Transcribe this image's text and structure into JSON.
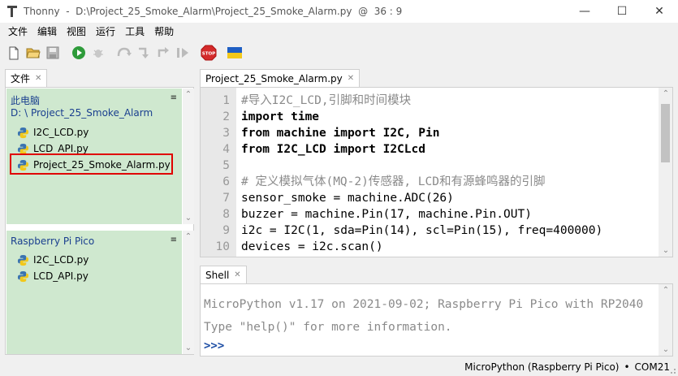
{
  "window": {
    "title": "Thonny  -  D:\\Project_25_Smoke_Alarm\\Project_25_Smoke_Alarm.py  @  36 : 9",
    "minimize": "—",
    "maximize": "☐",
    "close": "✕"
  },
  "menu": [
    "文件",
    "编辑",
    "视图",
    "运行",
    "工具",
    "帮助"
  ],
  "files": {
    "tab_label": "文件",
    "local": {
      "heading": "此电脑",
      "path": "D: \\ Project_25_Smoke_Alarm",
      "items": [
        "I2C_LCD.py",
        "LCD_API.py",
        "Project_25_Smoke_Alarm.py"
      ]
    },
    "device": {
      "heading": "Raspberry Pi Pico",
      "items": [
        "I2C_LCD.py",
        "LCD_API.py"
      ]
    }
  },
  "editor": {
    "tab_label": "Project_25_Smoke_Alarm.py",
    "line_numbers": [
      "1",
      "2",
      "3",
      "4",
      "5",
      "6",
      "7",
      "8",
      "9",
      "10"
    ],
    "lines": [
      "#导入I2C_LCD,引脚和时间模块",
      "import time",
      "from machine import I2C, Pin",
      "from I2C_LCD import I2CLcd",
      "",
      "# 定义模拟气体(MQ-2)传感器, LCD和有源蜂鸣器的引脚",
      "sensor_smoke = machine.ADC(26)",
      "buzzer = machine.Pin(17, machine.Pin.OUT)",
      "i2c = I2C(1, sda=Pin(14), scl=Pin(15), freq=400000)",
      "devices = i2c.scan()"
    ]
  },
  "shell": {
    "tab_label": "Shell",
    "line1": "MicroPython v1.17 on 2021-09-02; Raspberry Pi Pico with RP2040",
    "line2": "Type \"help()\" for more information.",
    "prompt": ">>>"
  },
  "status": {
    "interpreter": "MicroPython (Raspberry Pi Pico)",
    "separator": "•",
    "port": "COM21"
  },
  "icons": [
    "new-file-icon",
    "open-folder-icon",
    "save-icon",
    "run-icon",
    "debug-icon",
    "step-over-icon",
    "step-into-icon",
    "step-out-icon",
    "resume-icon",
    "stop-icon",
    "ukraine-flag-icon"
  ],
  "colors": {
    "files_section_bg": "#cfe8cf",
    "section_heading": "#1a3f8f",
    "highlight_border": "#e00000",
    "stop_red": "#d42a2a",
    "run_green": "#2e9b3a"
  }
}
